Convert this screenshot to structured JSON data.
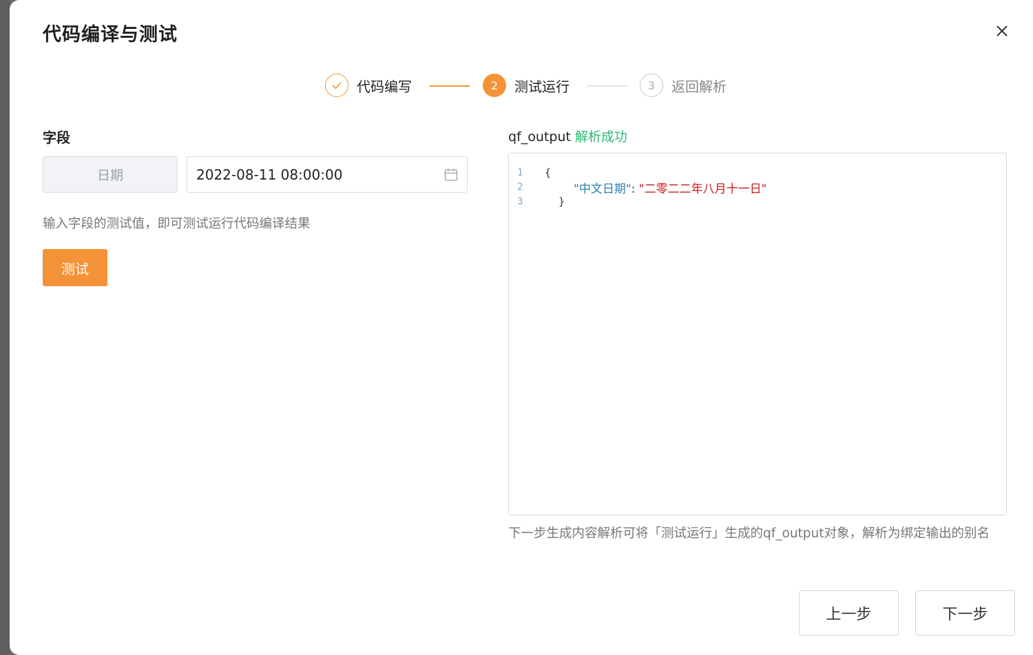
{
  "dialog": {
    "title": "代码编译与测试"
  },
  "steps": [
    {
      "number": "1",
      "label": "代码编写",
      "state": "done"
    },
    {
      "number": "2",
      "label": "测试运行",
      "state": "active"
    },
    {
      "number": "3",
      "label": "返回解析",
      "state": "wait"
    }
  ],
  "left": {
    "field_title": "字段",
    "field_name": "日期",
    "date_value": "2022-08-11 08:00:00",
    "hint": "输入字段的测试值，即可测试运行代码编译结果",
    "test_button": "测试"
  },
  "right": {
    "output_name": "qf_output",
    "status": "解析成功",
    "code": {
      "line_numbers": [
        "1",
        "2",
        "3"
      ],
      "open_brace": "{",
      "key": "\"中文日期\"",
      "colon": ": ",
      "value": "\"二零二二年八月十一日\"",
      "close_brace": "}"
    },
    "hint": "下一步生成内容解析可将「测试运行」生成的qf_output对象，解析为绑定输出的别名"
  },
  "footer": {
    "prev_button": "上一步",
    "next_button": "下一步"
  },
  "colors": {
    "accent": "#f39236",
    "success": "#2eb872",
    "json_key": "#2a7fb0",
    "json_string": "#c41d1d"
  }
}
